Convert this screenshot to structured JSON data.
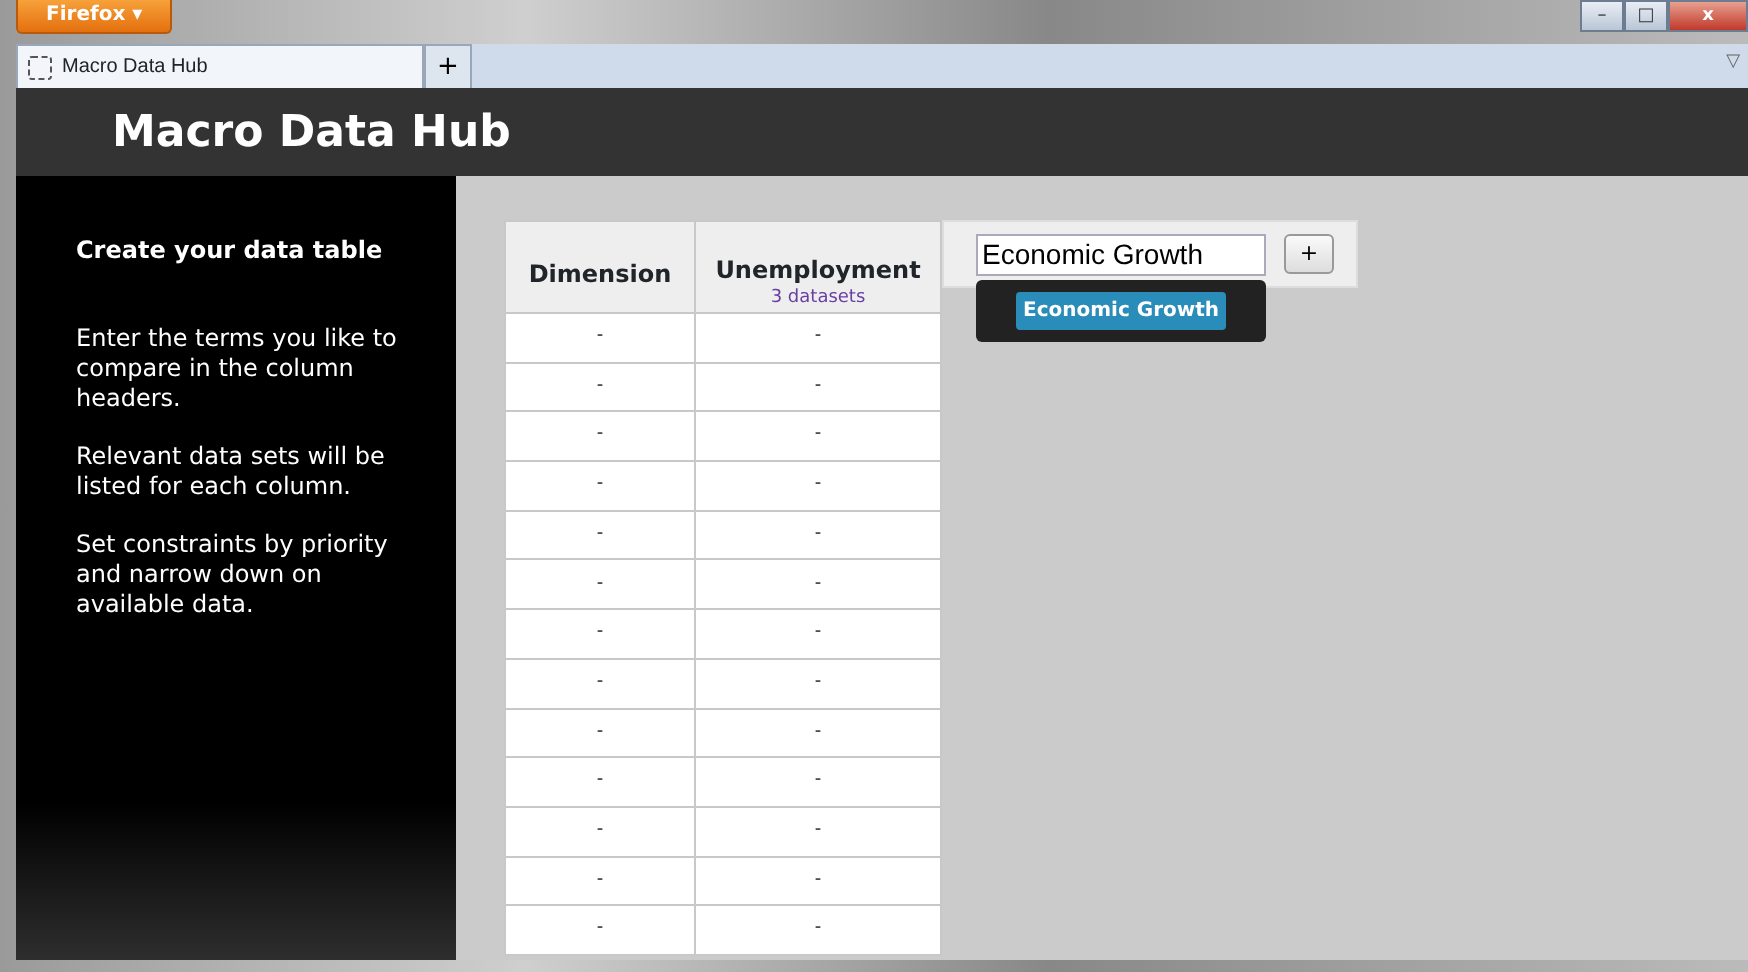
{
  "browser": {
    "menu_button": "Firefox ▾",
    "tabs": [
      {
        "label": "Macro Data Hub",
        "selected": true
      }
    ],
    "new_tab": "+",
    "window_controls": [
      "–",
      "□",
      "x"
    ],
    "tab_list": "▽"
  },
  "header": {
    "title": "Macro Data Hub"
  },
  "sidebar": {
    "heading": "Create your data table",
    "paragraphs": [
      "Enter the terms you like to compare in the column headers.",
      "Relevant data sets will be listed for each column.",
      "Set constraints by priority and narrow down on available data."
    ]
  },
  "table": {
    "columns": [
      {
        "title": "Dimension"
      },
      {
        "title": "Unemployment",
        "subtitle": "3 datasets"
      }
    ],
    "rows": [
      [
        "-",
        "-"
      ],
      [
        "-",
        "-"
      ],
      [
        "-",
        "-"
      ],
      [
        "-",
        "-"
      ],
      [
        "-",
        "-"
      ],
      [
        "-",
        "-"
      ],
      [
        "-",
        "-"
      ],
      [
        "-",
        "-"
      ],
      [
        "-",
        "-"
      ],
      [
        "-",
        "-"
      ],
      [
        "-",
        "-"
      ],
      [
        "-",
        "-"
      ],
      [
        "-",
        "-"
      ]
    ]
  },
  "new_column": {
    "value": "Economic Growth",
    "add_button": "+",
    "suggestions": [
      {
        "label": "Economic Growth",
        "selected": true
      }
    ]
  }
}
